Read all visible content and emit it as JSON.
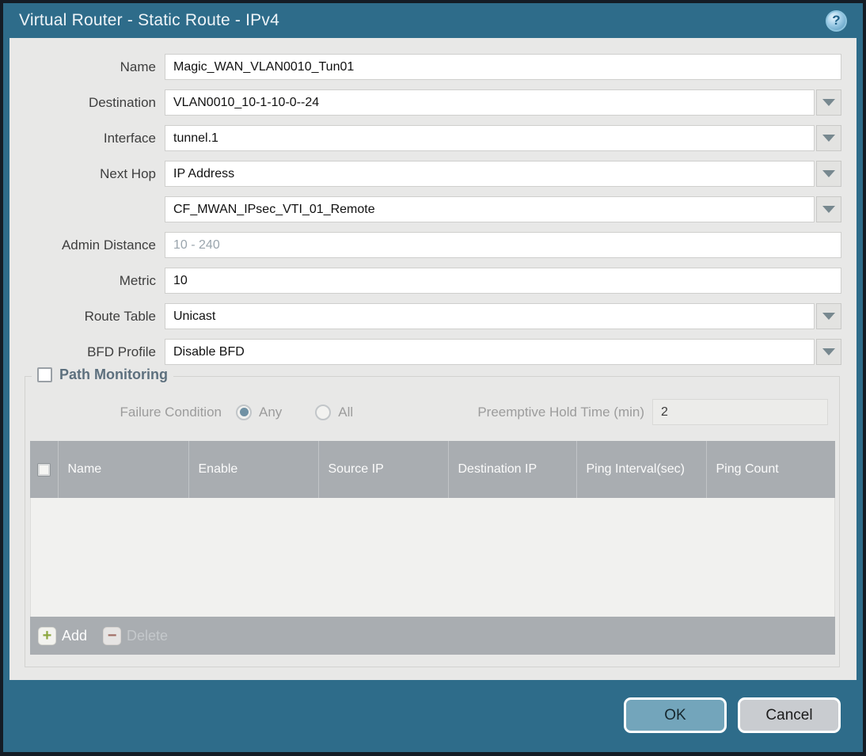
{
  "titlebar": {
    "title": "Virtual Router - Static Route - IPv4",
    "help_icon_glyph": "?"
  },
  "form": {
    "name": {
      "label": "Name",
      "value": "Magic_WAN_VLAN0010_Tun01"
    },
    "destination": {
      "label": "Destination",
      "value": "VLAN0010_10-1-10-0--24"
    },
    "interface": {
      "label": "Interface",
      "value": "tunnel.1"
    },
    "next_hop": {
      "label": "Next Hop",
      "value": "IP Address"
    },
    "next_hop_address": {
      "value": "CF_MWAN_IPsec_VTI_01_Remote"
    },
    "admin_distance": {
      "label": "Admin Distance",
      "value": "",
      "placeholder": "10 - 240"
    },
    "metric": {
      "label": "Metric",
      "value": "10"
    },
    "route_table": {
      "label": "Route Table",
      "value": "Unicast"
    },
    "bfd_profile": {
      "label": "BFD Profile",
      "value": "Disable BFD"
    }
  },
  "path_monitoring": {
    "title": "Path Monitoring",
    "checkbox_checked": false,
    "failure_condition": {
      "label": "Failure Condition",
      "options": [
        {
          "label": "Any",
          "selected": true
        },
        {
          "label": "All",
          "selected": false
        }
      ]
    },
    "preemptive_hold": {
      "label": "Preemptive Hold Time (min)",
      "value": "2"
    },
    "table": {
      "columns": [
        "Name",
        "Enable",
        "Source IP",
        "Destination IP",
        "Ping Interval(sec)",
        "Ping Count"
      ],
      "rows": []
    },
    "toolbar": {
      "add_label": "Add",
      "add_icon_glyph": "+",
      "delete_label": "Delete",
      "delete_icon_glyph": "−",
      "delete_enabled": false
    }
  },
  "footer": {
    "ok_label": "OK",
    "cancel_label": "Cancel"
  },
  "colors": {
    "frame_teal": "#2e6c8a",
    "outer_border": "#141c25",
    "panel_gray": "#e8e8e7",
    "table_header_gray": "#a9adb1",
    "ok_button_blue": "#73a5bb",
    "cancel_button_gray": "#c9ccd0",
    "add_icon_green": "#8ca73f",
    "delete_icon_red": "#a0675e",
    "disabled_text": "#9c9c9c"
  }
}
